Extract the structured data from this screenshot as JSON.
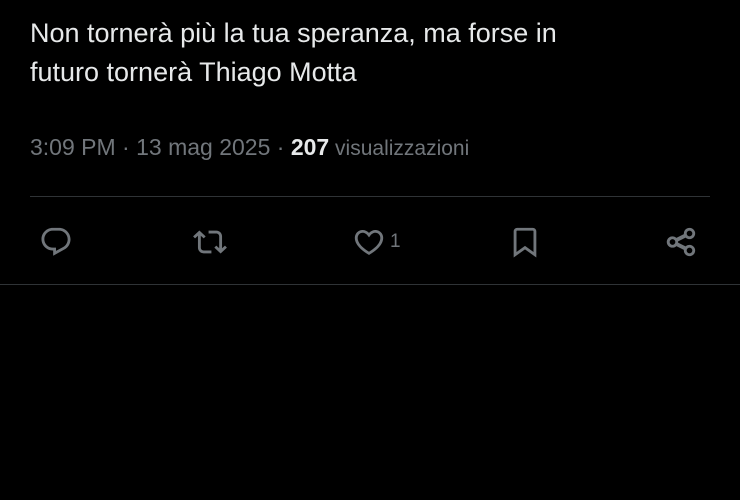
{
  "tweet": {
    "text_line1": "Non tornerà più la tua speranza, ma forse in",
    "text_line2": "futuro tornerà Thiago Motta"
  },
  "meta": {
    "time": "3:09 PM",
    "separator1": " · ",
    "date": "13 mag 2025",
    "separator2": " · ",
    "views_count": "207",
    "views_label": " visualizzazioni"
  },
  "actions": {
    "reply_icon": "reply-icon",
    "retweet_icon": "retweet-icon",
    "like_icon": "heart-icon",
    "like_count": "1",
    "bookmark_icon": "bookmark-icon",
    "share_icon": "share-icon"
  },
  "colors": {
    "background": "#000000",
    "text_primary": "#e7e9ea",
    "text_secondary": "#71767b",
    "divider": "#2f3336"
  }
}
